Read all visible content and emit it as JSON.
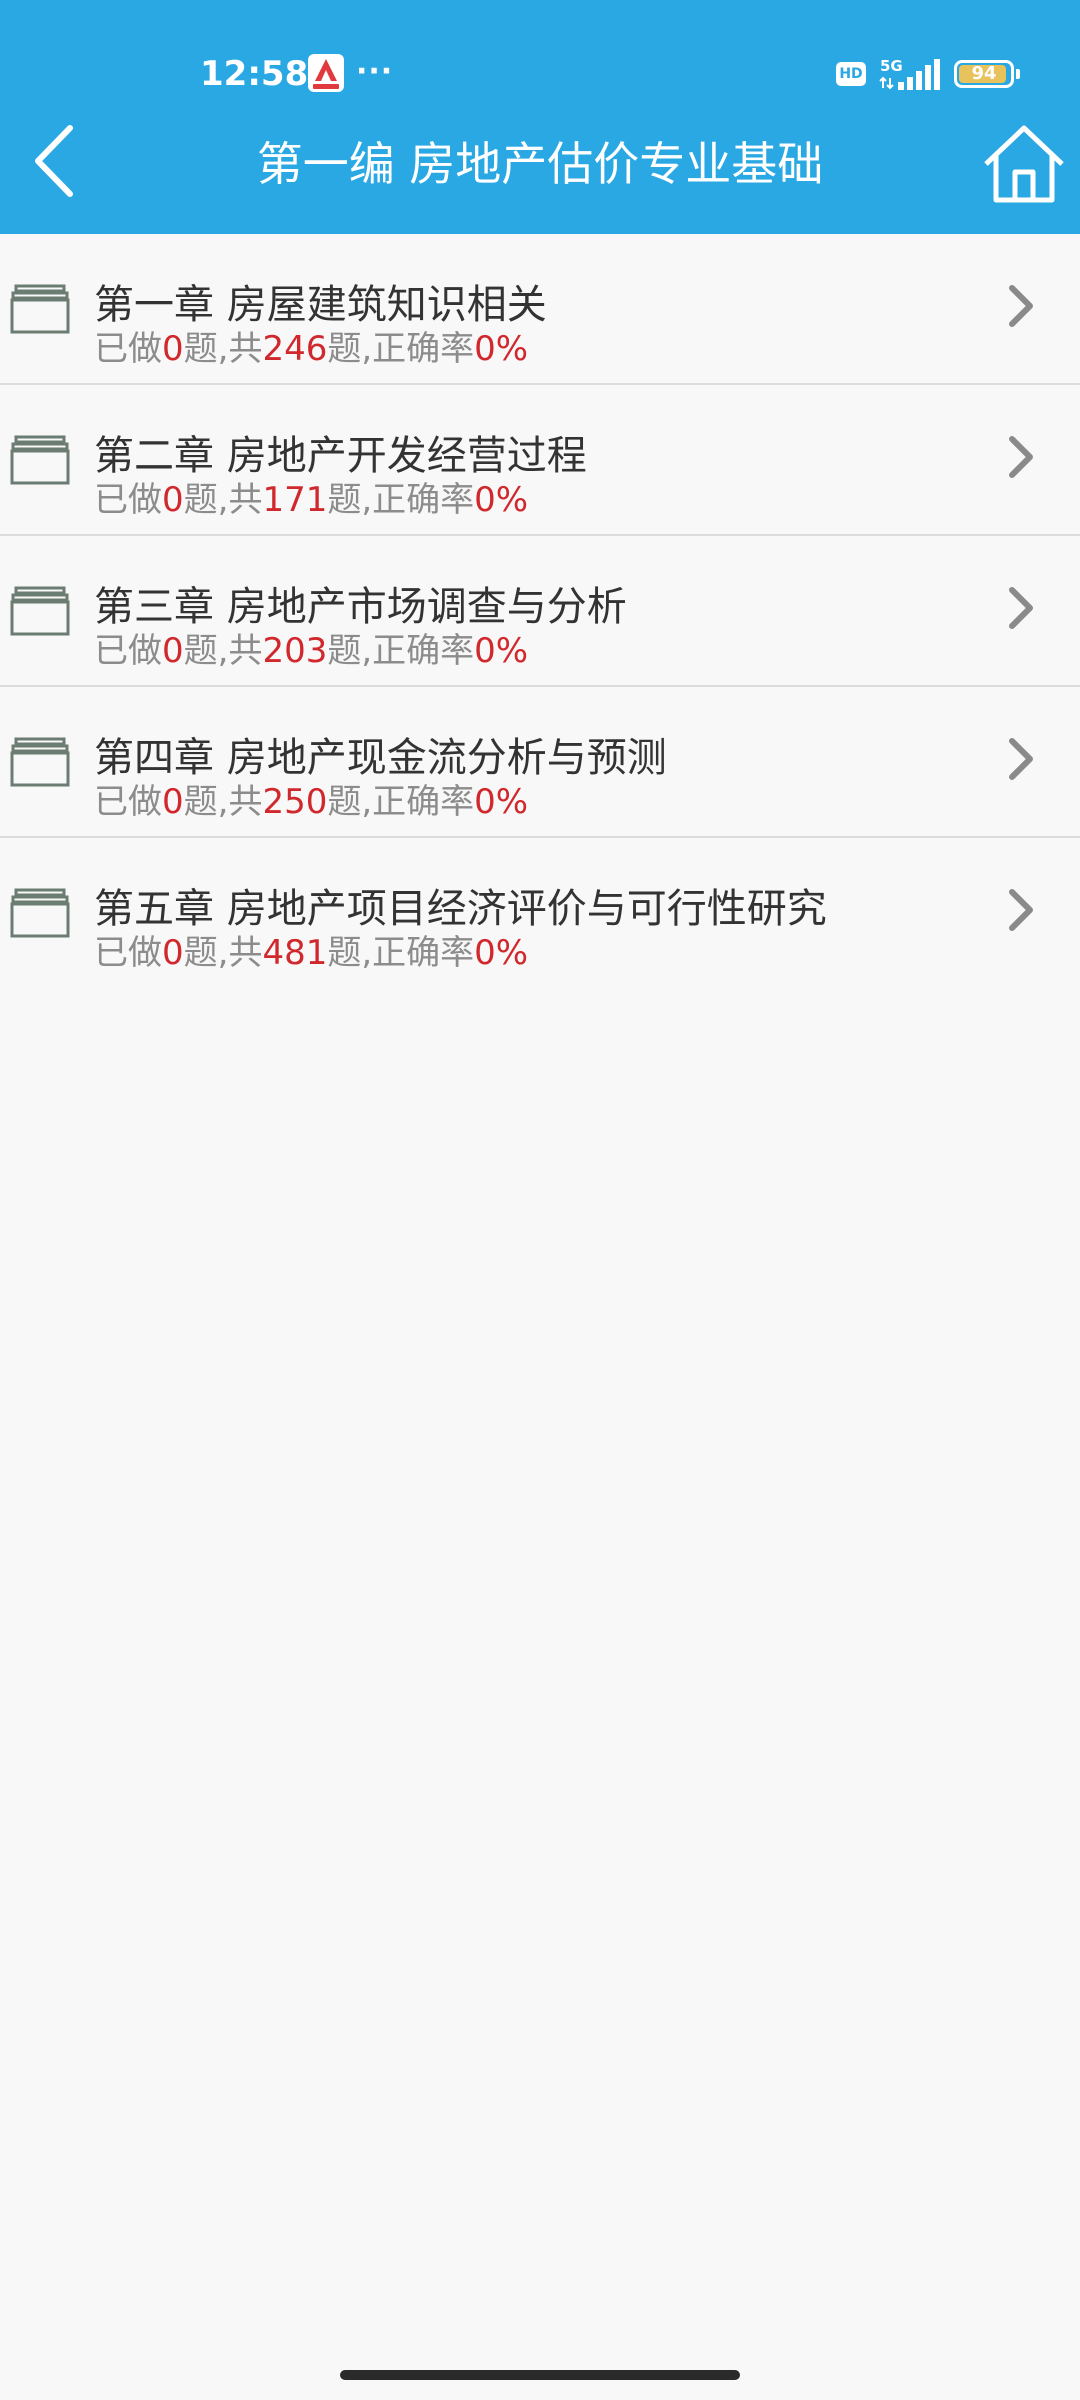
{
  "status_bar": {
    "time": "12:58",
    "more": "···",
    "hd": "HD",
    "network": "5G",
    "battery": 94,
    "battery_label": "94"
  },
  "header": {
    "title": "第一编 房地产估价专业基础",
    "back_icon": "chevron-left-icon",
    "home_icon": "home-icon"
  },
  "colors": {
    "header_bg": "#29a8e3",
    "highlight": "#d0282c",
    "stats_text": "#8c8c8c",
    "title_text": "#333333"
  },
  "stats_labels": {
    "done_prefix": "已做",
    "done_suffix": "题,共",
    "total_suffix": "题,正确率"
  },
  "chapters": [
    {
      "title": "第一章 房屋建筑知识相关",
      "done": "0",
      "total": "246",
      "accuracy": "0%"
    },
    {
      "title": "第二章 房地产开发经营过程",
      "done": "0",
      "total": "171",
      "accuracy": "0%"
    },
    {
      "title": "第三章 房地产市场调查与分析",
      "done": "0",
      "total": "203",
      "accuracy": "0%"
    },
    {
      "title": "第四章 房地产现金流分析与预测",
      "done": "0",
      "total": "250",
      "accuracy": "0%"
    },
    {
      "title": "第五章 房地产项目经济评价与可行性研究",
      "done": "0",
      "total": "481",
      "accuracy": "0%"
    }
  ]
}
